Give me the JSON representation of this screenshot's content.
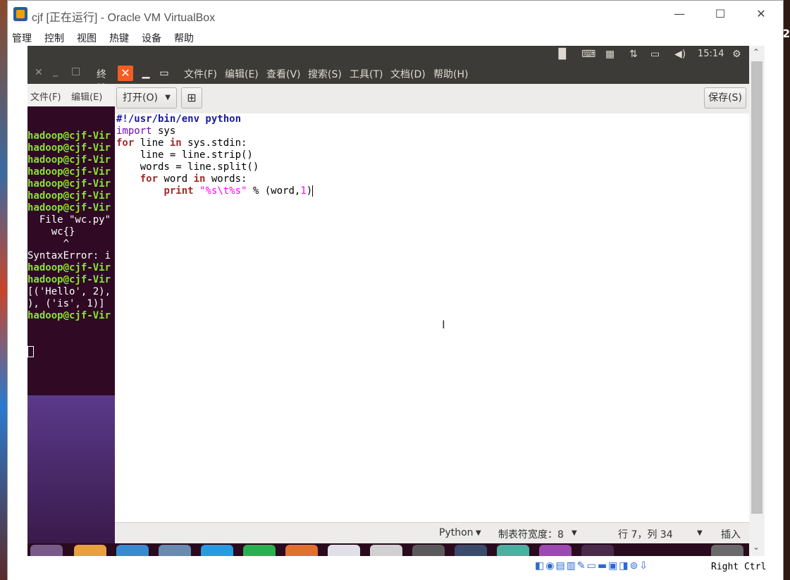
{
  "host": {
    "window_title": "cjf [正在运行] - Oracle VM VirtualBox",
    "controls": {
      "minimize": "—",
      "maximize": "☐",
      "close": "✕"
    },
    "menu": [
      "管理",
      "控制",
      "视图",
      "热键",
      "设备",
      "帮助"
    ],
    "host_key_label": "Right Ctrl",
    "side_chars": {
      "right_top": "2"
    }
  },
  "guest": {
    "topbar": {
      "time": "15:14"
    },
    "terminal": {
      "title": "终端",
      "menu": [
        "文件(F)",
        "编辑(E)"
      ],
      "lines": [
        {
          "text": "hadoop@cjf-Vir",
          "prompt": true
        },
        {
          "text": "hadoop@cjf-Vir",
          "prompt": true
        },
        {
          "text": "hadoop@cjf-Vir",
          "prompt": true
        },
        {
          "text": "hadoop@cjf-Vir",
          "prompt": true
        },
        {
          "text": "hadoop@cjf-Vir",
          "prompt": true
        },
        {
          "text": "hadoop@cjf-Vir",
          "prompt": true
        },
        {
          "text": "hadoop@cjf-Vir",
          "prompt": true
        },
        {
          "text": "  File \"wc.py\"",
          "prompt": false
        },
        {
          "text": "    wc{}",
          "prompt": false
        },
        {
          "text": "      ^",
          "prompt": false
        },
        {
          "text": "SyntaxError: i",
          "prompt": false
        },
        {
          "text": "hadoop@cjf-Vir",
          "prompt": true
        },
        {
          "text": "hadoop@cjf-Vir",
          "prompt": true
        },
        {
          "text": "[('Hello', 2),",
          "prompt": false
        },
        {
          "text": "), ('is', 1)]",
          "prompt": false
        },
        {
          "text": "hadoop@cjf-Vir",
          "prompt": true
        }
      ]
    },
    "gedit": {
      "menu": [
        "文件(F)",
        "编辑(E)",
        "查看(V)",
        "搜索(S)",
        "工具(T)",
        "文档(D)",
        "帮助(H)"
      ],
      "open_button": "打开(O)",
      "save_button": "保存(S)",
      "code": {
        "l1": "#!/usr/bin/env python",
        "l2_kw": "import",
        "l2_rest": " sys",
        "l3_kw": "for",
        "l3_a": " line ",
        "l3_in": "in",
        "l3_b": " sys.stdin:",
        "l4": "    line = line.strip()",
        "l5": "    words = line.split()",
        "l6_pre": "    ",
        "l6_kw": "for",
        "l6_a": " word ",
        "l6_in": "in",
        "l6_b": " words:",
        "l7_pre": "        ",
        "l7_kw": "print",
        "l7_sp": " ",
        "l7_str": "\"%s\\t%s\"",
        "l7_mid": " % (word,",
        "l7_num": "1",
        "l7_end": ")"
      },
      "status": {
        "language": "Python",
        "tab_width": "制表符宽度：8",
        "position": "行 7，列 34",
        "mode": "插入"
      }
    }
  }
}
